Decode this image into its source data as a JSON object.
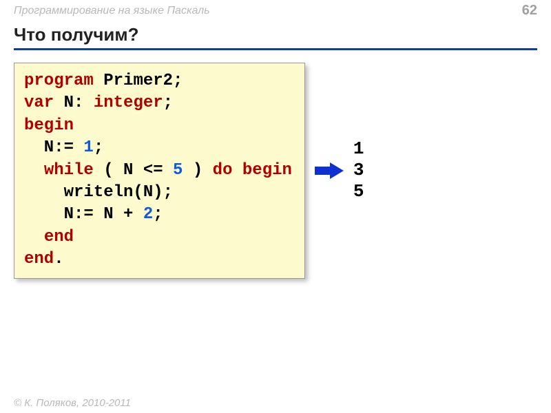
{
  "header": {
    "subject": "Программирование на языке Паскаль",
    "page": "62"
  },
  "title": "Что получим?",
  "code": {
    "l1_kw": "program",
    "l1_t": " Primer2;",
    "l2_kw": "var",
    "l2_t1": " N: ",
    "l2_kw2": "integer",
    "l2_t2": ";",
    "l3_kw": "begin",
    "l4_t1": "  N:= ",
    "l4_n": "1",
    "l4_t2": ";",
    "l5_sp": "  ",
    "l5_kw1": "while",
    "l5_t1": " ( N <= ",
    "l5_n": "5",
    "l5_t2": " ) ",
    "l5_kw2": "do",
    "l5_t3": " ",
    "l5_kw3": "begin",
    "l6_t": "    writeln(N);",
    "l7_t1": "    N:= N + ",
    "l7_n": "2",
    "l7_t2": ";",
    "l8_sp": "  ",
    "l8_kw": "end",
    "l9_kw": "end",
    "l9_t": "."
  },
  "output": "1\n3\n5",
  "footer": "© К. Поляков, 2010-2011"
}
